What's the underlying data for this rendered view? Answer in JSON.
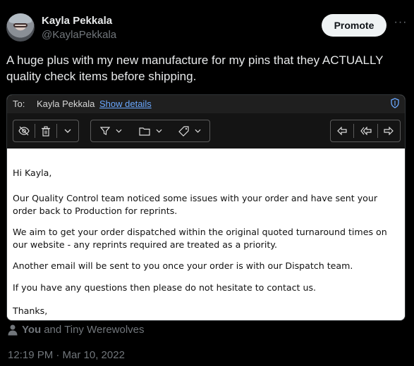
{
  "tweet": {
    "author_name": "Kayla Pekkala",
    "author_handle": "@KaylaPekkala",
    "promote_label": "Promote",
    "more_label": "···",
    "text": "A huge plus with my new manufacture for my pins that they ACTUALLY quality check items before shipping.",
    "likers_you": "You",
    "likers_rest": "and Tiny Werewolves",
    "timestamp": "12:19 PM · Mar 10, 2022"
  },
  "email": {
    "to_label": "To:",
    "to_name": "Kayla Pekkala",
    "show_details": "Show details",
    "body": [
      "Hi Kayla,",
      "Our Quality Control team noticed some issues with your order and have sent your order back to Production for reprints.",
      "We aim to get your order dispatched within the original quoted turnaround times on our website - any reprints required are treated as a priority.",
      "Another email will be sent to you once your order is with our Dispatch team.",
      "If you have any questions then please do not hesitate to contact us.",
      "Thanks,"
    ],
    "toolbar_icons": [
      "eye-slash-icon",
      "trash-icon",
      "chevron-down-icon",
      "filter-icon",
      "folder-icon",
      "tag-icon",
      "reply-icon",
      "reply-all-icon",
      "forward-icon"
    ]
  }
}
